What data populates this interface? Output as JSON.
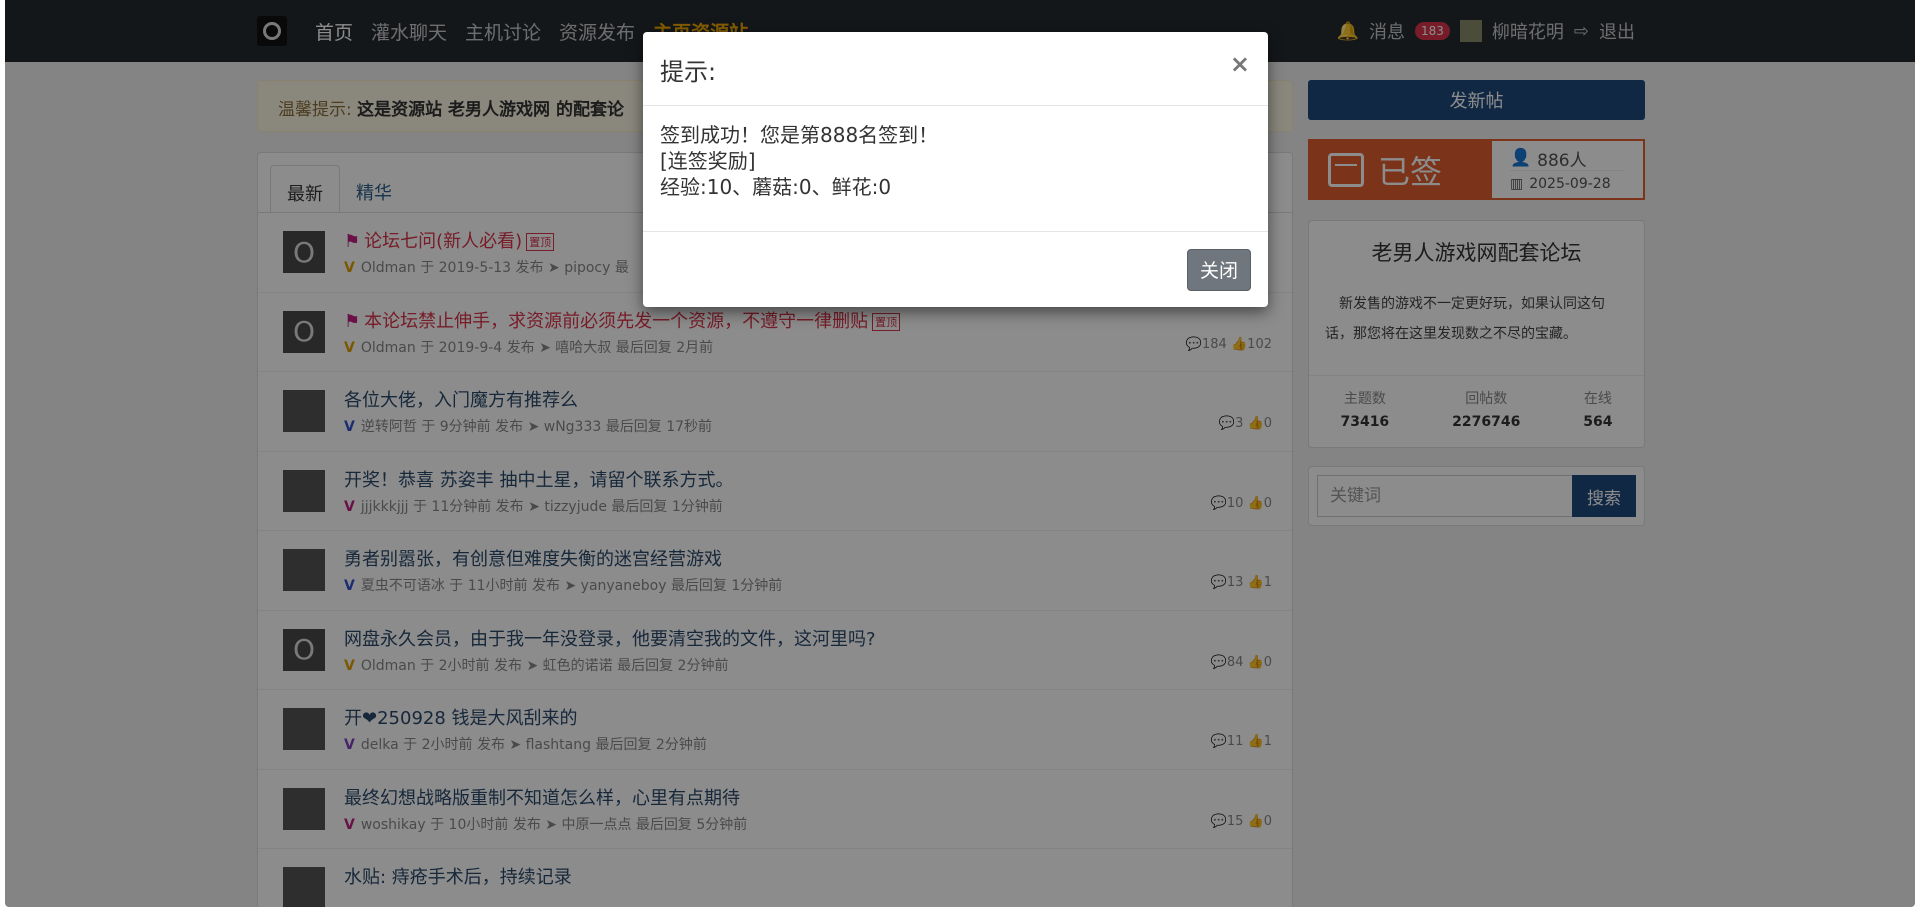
{
  "navbar": {
    "links": [
      "首页",
      "灌水聊天",
      "主机讨论",
      "资源发布",
      "主页资源站"
    ],
    "messages_label": "消息",
    "messages_count": "183",
    "username": "柳暗花明",
    "logout_label": "退出"
  },
  "notice": {
    "prefix": "温馨提示:",
    "text": "这是资源站 老男人游戏网 的配套论"
  },
  "tabs": [
    "最新",
    "精华"
  ],
  "threads": [
    {
      "title": "论坛七问(新人必看)",
      "pinned": true,
      "pin_tag": "置顶",
      "author": "Oldman",
      "posted": "于 2019-5-13 发布",
      "last_user": "pipocy",
      "last_label": "最",
      "last_time": "",
      "replies": "",
      "likes": "",
      "level": "V"
    },
    {
      "title": "本论坛禁止伸手，求资源前必须先发一个资源，不遵守一律删贴",
      "pinned": true,
      "pin_tag": "置顶",
      "author": "Oldman",
      "posted": "于 2019-9-4 发布",
      "last_user": "嘻哈大叔",
      "last_label": "最后回复",
      "last_time": "2月前",
      "replies": "184",
      "likes": "102",
      "level": "V"
    },
    {
      "title": "各位大佬，入门魔方有推荐么",
      "pinned": false,
      "author": "逆转阿哲",
      "posted": "于 9分钟前 发布",
      "last_user": "wNg333",
      "last_label": "最后回复",
      "last_time": "17秒前",
      "replies": "3",
      "likes": "0",
      "level": "V"
    },
    {
      "title": "开奖！恭喜 苏姿丰 抽中土星，请留个联系方式。",
      "pinned": false,
      "author": "jjjkkkjjj",
      "posted": "于 11分钟前 发布",
      "last_user": "tizzyjude",
      "last_label": "最后回复",
      "last_time": "1分钟前",
      "replies": "10",
      "likes": "0",
      "level": "V"
    },
    {
      "title": "勇者别嚣张，有创意但难度失衡的迷宫经营游戏",
      "pinned": false,
      "author": "夏虫不可语冰",
      "posted": "于 11小时前 发布",
      "last_user": "yanyaneboy",
      "last_label": "最后回复",
      "last_time": "1分钟前",
      "replies": "13",
      "likes": "1",
      "level": "V"
    },
    {
      "title": "网盘永久会员，由于我一年没登录，他要清空我的文件，这河里吗?",
      "pinned": false,
      "author": "Oldman",
      "posted": "于 2小时前 发布",
      "last_user": "虹色的诺诺",
      "last_label": "最后回复",
      "last_time": "2分钟前",
      "replies": "84",
      "likes": "0",
      "level": "V"
    },
    {
      "title": "开❤250928 钱是大风刮来的",
      "pinned": false,
      "author": "delka",
      "posted": "于 2小时前 发布",
      "last_user": "flashtang",
      "last_label": "最后回复",
      "last_time": "2分钟前",
      "replies": "11",
      "likes": "1",
      "level": "V"
    },
    {
      "title": "最终幻想战略版重制不知道怎么样，心里有点期待",
      "pinned": false,
      "author": "woshikay",
      "posted": "于 10小时前 发布",
      "last_user": "中原一点点",
      "last_label": "最后回复",
      "last_time": "5分钟前",
      "replies": "15",
      "likes": "0",
      "level": "V"
    },
    {
      "title": "水贴: 痔疮手术后，持续记录",
      "pinned": false,
      "author": "",
      "posted": "",
      "last_user": "",
      "last_label": "",
      "last_time": "",
      "replies": "",
      "likes": "",
      "level": ""
    }
  ],
  "sidebar": {
    "new_post": "发新帖",
    "checkin_label": "已签",
    "checkin_count": "886人",
    "checkin_date": "2025-09-28",
    "forum_title": "老男人游戏网配套论坛",
    "forum_desc": "新发售的游戏不一定更好玩，如果认同这句话，那您将在这里发现数之不尽的宝藏。",
    "stats": [
      {
        "label": "主题数",
        "value": "73416"
      },
      {
        "label": "回帖数",
        "value": "2276746"
      },
      {
        "label": "在线",
        "value": "564"
      }
    ],
    "search_placeholder": "关键词",
    "search_button": "搜索"
  },
  "modal": {
    "title": "提示:",
    "line1": "签到成功！您是第888名签到！",
    "line2": "[连签奖励]",
    "line3": "经验:10、蘑菇:0、鲜花:0",
    "close_button": "关闭",
    "close_x": "×"
  },
  "colors": {
    "navbar": "#262a31",
    "accent": "#1e4a7a",
    "checkin": "#e06030",
    "pinned": "#d9344a"
  }
}
